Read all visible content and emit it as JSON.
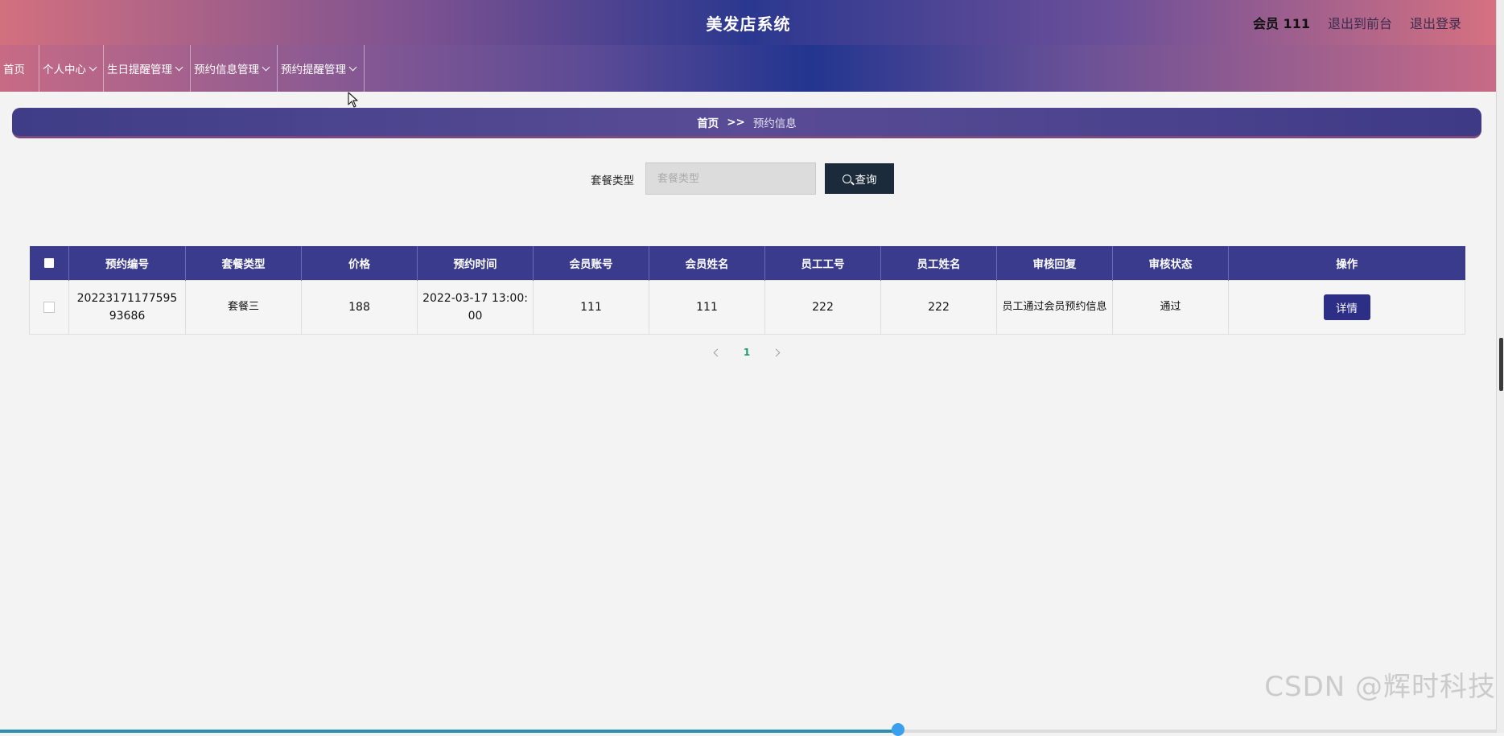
{
  "header": {
    "title": "美发店系统",
    "user_label": "会员 111",
    "front_link": "退出到前台",
    "logout_link": "退出登录"
  },
  "nav": {
    "home": "首页",
    "personal": "个人中心",
    "birthday": "生日提醒管理",
    "appointment_info": "预约信息管理",
    "appointment_reminder": "预约提醒管理"
  },
  "breadcrumb": {
    "home": "首页",
    "sep": ">>",
    "current": "预约信息"
  },
  "search": {
    "label": "套餐类型",
    "placeholder": "套餐类型",
    "value": "",
    "button_label": "查询"
  },
  "table": {
    "headers": [
      "预约编号",
      "套餐类型",
      "价格",
      "预约时间",
      "会员账号",
      "会员姓名",
      "员工工号",
      "员工姓名",
      "审核回复",
      "审核状态",
      "操作"
    ],
    "rows": [
      {
        "appointment_no": "2022317117759593686",
        "package_type": "套餐三",
        "price": "188",
        "appointment_time": "2022-03-17 13:00:00",
        "member_account": "111",
        "member_name": "111",
        "staff_no": "222",
        "staff_name": "222",
        "review_reply": "员工通过会员预约信息",
        "review_status": "通过",
        "detail_label": "详情"
      }
    ]
  },
  "pagination": {
    "current_page": "1"
  },
  "watermark": "CSDN @辉时科技",
  "colors": {
    "header_dark": "#2b388f",
    "header_pink": "#d2707f",
    "table_header": "#3a3b8c",
    "search_button": "#1b2b3b",
    "detail_button": "#2d2f86",
    "page_active": "#1c9a6c"
  },
  "playback_progress": 0.6
}
